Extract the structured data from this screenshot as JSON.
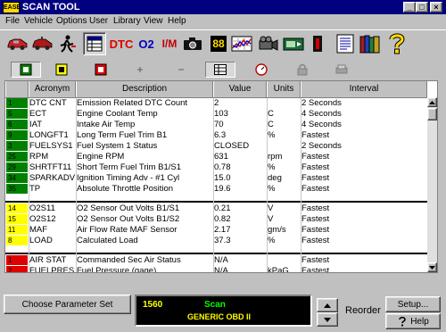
{
  "window": {
    "icon_text": "EASE",
    "title": "SCAN TOOL",
    "minimize": "_",
    "maximize": "□",
    "close": "×"
  },
  "menu": [
    "File",
    "Vehicle",
    "Options",
    "User",
    "Library",
    "View",
    "Help"
  ],
  "toolbar": {
    "dtc_label": "DTC",
    "o2_label": "O2",
    "im_label": "I/M",
    "gauge_label": "88"
  },
  "table": {
    "headers": [
      "Acronym",
      "Description",
      "Value",
      "Units",
      "Interval"
    ],
    "rows": [
      {
        "acronym": "DTC CNT",
        "description": "Emission Related DTC Count",
        "value": "2",
        "units": "",
        "interval": "2 Seconds",
        "index": "1",
        "color": "#008000"
      },
      {
        "acronym": "ECT",
        "description": "Engine Coolant Temp",
        "value": "103",
        "units": "C",
        "interval": "4 Seconds",
        "index": "5",
        "color": "#008000"
      },
      {
        "acronym": "IAT",
        "description": "Intake Air Temp",
        "value": "70",
        "units": "C",
        "interval": "4 Seconds",
        "index": "6",
        "color": "#008000"
      },
      {
        "acronym": "LONGFT1",
        "description": "Long Term Fuel Trim B1",
        "value": "6.3",
        "units": "%",
        "interval": "Fastest",
        "index": "9",
        "color": "#008000"
      },
      {
        "acronym": "FUELSYS1",
        "description": "Fuel System 1 Status",
        "value": "CLOSED",
        "units": "",
        "interval": "2 Seconds",
        "index": "3",
        "color": "#008000"
      },
      {
        "acronym": "RPM",
        "description": "Engine RPM",
        "value": "631",
        "units": "rpm",
        "interval": "Fastest",
        "index": "25",
        "color": "#008000"
      },
      {
        "acronym": "SHRTFT11",
        "description": "Short Term Fuel Trim B1/S1",
        "value": "0.78",
        "units": "%",
        "interval": "Fastest",
        "index": "29",
        "color": "#008000"
      },
      {
        "acronym": "SPARKADV",
        "description": "Ignition Timing Adv - #1 Cyl",
        "value": "15.0",
        "units": "deg",
        "interval": "Fastest",
        "index": "34",
        "color": "#008000"
      },
      {
        "acronym": "TP",
        "description": "Absolute Throttle Position",
        "value": "19.6",
        "units": "%",
        "interval": "Fastest",
        "index": "35",
        "color": "#008000"
      },
      {
        "acronym": "O2S11",
        "description": "O2 Sensor Out Volts B1/S1",
        "value": "0.21",
        "units": "V",
        "interval": "Fastest",
        "index": "14",
        "color": "#ffff00"
      },
      {
        "acronym": "O2S12",
        "description": "O2 Sensor Out Volts B1/S2",
        "value": "0.82",
        "units": "V",
        "interval": "Fastest",
        "index": "15",
        "color": "#ffff00"
      },
      {
        "acronym": "MAF",
        "description": "Air Flow Rate MAF Sensor",
        "value": "2.17",
        "units": "gm/s",
        "interval": "Fastest",
        "index": "11",
        "color": "#ffff00"
      },
      {
        "acronym": "LOAD",
        "description": "Calculated Load",
        "value": "37.3",
        "units": "%",
        "interval": "Fastest",
        "index": "8",
        "color": "#ffff00"
      },
      {
        "acronym": "AIR STAT",
        "description": "Commanded Sec Air Status",
        "value": "N/A",
        "units": "",
        "interval": "Fastest",
        "index": "1",
        "color": "#e00000"
      },
      {
        "acronym": "FUELPRES",
        "description": "Fuel Pressure (gage)",
        "value": "N/A",
        "units": "kPaG",
        "interval": "Fastest",
        "index": "2",
        "color": "#e00000"
      }
    ]
  },
  "bottom": {
    "choose_button": "Choose Parameter Set",
    "display_number": "1560",
    "display_mode": "Scan",
    "display_protocol": "GENERIC OBD II",
    "reorder_label": "Reorder",
    "setup_button": "Setup...",
    "help_button": "Help"
  },
  "colors": {
    "group_green": "#008000",
    "group_yellow": "#ffff00",
    "group_red": "#e00000",
    "title_bar": "#000080",
    "display_text_yellow": "#ffff00",
    "display_text_green": "#00ff00"
  }
}
